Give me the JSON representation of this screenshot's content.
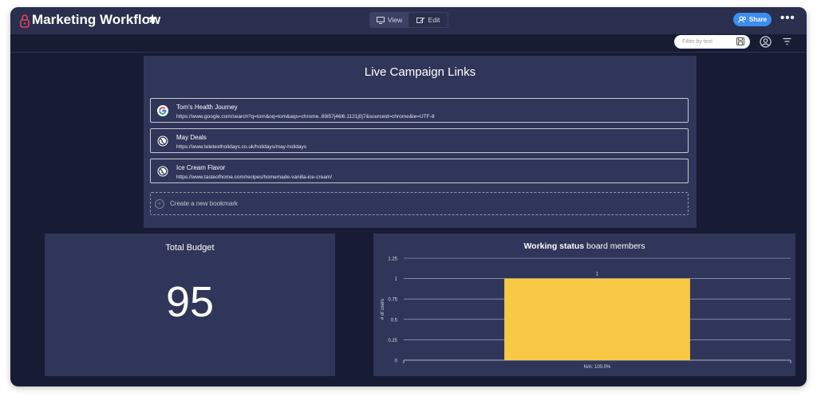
{
  "header": {
    "title": "Marketing Workflow",
    "view_label": "View",
    "edit_label": "Edit",
    "share_label": "Share",
    "more_label": "•••"
  },
  "toolbar": {
    "filter_placeholder": "Filter by text"
  },
  "links_widget": {
    "title": "Live Campaign Links",
    "links": [
      {
        "name": "Tom's Health Journey",
        "url": "https://www.google.com/search?q=tom&oq=tom&aqs=chrome..69i57j46l6.1121j0j7&sourceid=chrome&ie=UTF-8",
        "icon": "google-icon"
      },
      {
        "name": "May Deals",
        "url": "https://www.teletextholidays.co.uk/holidays/may-holidays",
        "icon": "globe-icon"
      },
      {
        "name": "Ice Cream Flavor",
        "url": "https://www.tasteofhome.com/recipes/homemade-vanilla-ice-cream/",
        "icon": "globe-icon"
      }
    ],
    "new_bookmark_label": "Create a new bookmark"
  },
  "budget_widget": {
    "title": "Total Budget",
    "value": "95"
  },
  "chart_widget": {
    "title_bold": "Working status",
    "title_rest": " board members"
  },
  "colors": {
    "background": "#181b34",
    "panel": "#30365a",
    "topbar": "#292f4c",
    "share": "#3d8cf0",
    "bar": "#f8c944"
  },
  "chart_data": {
    "type": "bar",
    "title": "Working status board members",
    "categories": [
      "N/A: 100.0%"
    ],
    "values": [
      1
    ],
    "data_labels": [
      "1"
    ],
    "ylabel": "# of users",
    "xlabel": "",
    "ylim": [
      0,
      1.25
    ],
    "yticks": [
      0,
      0.25,
      0.5,
      0.75,
      1,
      1.25
    ],
    "ytick_labels": [
      "0",
      "0.25",
      "0.5",
      "0.75",
      "1",
      "1.25"
    ],
    "grid": true,
    "bar_color": "#f8c944"
  }
}
